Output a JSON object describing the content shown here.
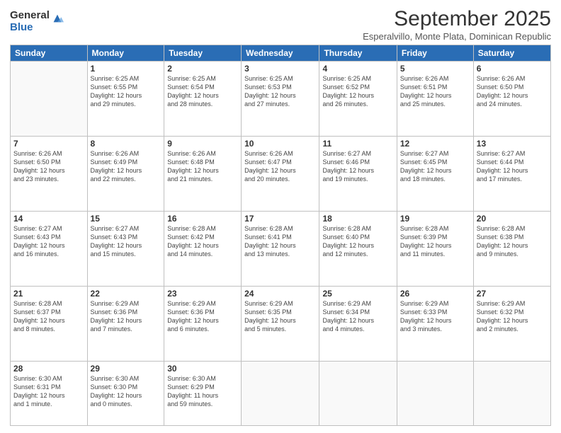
{
  "logo": {
    "general": "General",
    "blue": "Blue"
  },
  "header": {
    "month": "September 2025",
    "location": "Esperalvillo, Monte Plata, Dominican Republic"
  },
  "weekdays": [
    "Sunday",
    "Monday",
    "Tuesday",
    "Wednesday",
    "Thursday",
    "Friday",
    "Saturday"
  ],
  "weeks": [
    [
      {
        "day": "",
        "info": ""
      },
      {
        "day": "1",
        "info": "Sunrise: 6:25 AM\nSunset: 6:55 PM\nDaylight: 12 hours\nand 29 minutes."
      },
      {
        "day": "2",
        "info": "Sunrise: 6:25 AM\nSunset: 6:54 PM\nDaylight: 12 hours\nand 28 minutes."
      },
      {
        "day": "3",
        "info": "Sunrise: 6:25 AM\nSunset: 6:53 PM\nDaylight: 12 hours\nand 27 minutes."
      },
      {
        "day": "4",
        "info": "Sunrise: 6:25 AM\nSunset: 6:52 PM\nDaylight: 12 hours\nand 26 minutes."
      },
      {
        "day": "5",
        "info": "Sunrise: 6:26 AM\nSunset: 6:51 PM\nDaylight: 12 hours\nand 25 minutes."
      },
      {
        "day": "6",
        "info": "Sunrise: 6:26 AM\nSunset: 6:50 PM\nDaylight: 12 hours\nand 24 minutes."
      }
    ],
    [
      {
        "day": "7",
        "info": "Sunrise: 6:26 AM\nSunset: 6:50 PM\nDaylight: 12 hours\nand 23 minutes."
      },
      {
        "day": "8",
        "info": "Sunrise: 6:26 AM\nSunset: 6:49 PM\nDaylight: 12 hours\nand 22 minutes."
      },
      {
        "day": "9",
        "info": "Sunrise: 6:26 AM\nSunset: 6:48 PM\nDaylight: 12 hours\nand 21 minutes."
      },
      {
        "day": "10",
        "info": "Sunrise: 6:26 AM\nSunset: 6:47 PM\nDaylight: 12 hours\nand 20 minutes."
      },
      {
        "day": "11",
        "info": "Sunrise: 6:27 AM\nSunset: 6:46 PM\nDaylight: 12 hours\nand 19 minutes."
      },
      {
        "day": "12",
        "info": "Sunrise: 6:27 AM\nSunset: 6:45 PM\nDaylight: 12 hours\nand 18 minutes."
      },
      {
        "day": "13",
        "info": "Sunrise: 6:27 AM\nSunset: 6:44 PM\nDaylight: 12 hours\nand 17 minutes."
      }
    ],
    [
      {
        "day": "14",
        "info": "Sunrise: 6:27 AM\nSunset: 6:43 PM\nDaylight: 12 hours\nand 16 minutes."
      },
      {
        "day": "15",
        "info": "Sunrise: 6:27 AM\nSunset: 6:43 PM\nDaylight: 12 hours\nand 15 minutes."
      },
      {
        "day": "16",
        "info": "Sunrise: 6:28 AM\nSunset: 6:42 PM\nDaylight: 12 hours\nand 14 minutes."
      },
      {
        "day": "17",
        "info": "Sunrise: 6:28 AM\nSunset: 6:41 PM\nDaylight: 12 hours\nand 13 minutes."
      },
      {
        "day": "18",
        "info": "Sunrise: 6:28 AM\nSunset: 6:40 PM\nDaylight: 12 hours\nand 12 minutes."
      },
      {
        "day": "19",
        "info": "Sunrise: 6:28 AM\nSunset: 6:39 PM\nDaylight: 12 hours\nand 11 minutes."
      },
      {
        "day": "20",
        "info": "Sunrise: 6:28 AM\nSunset: 6:38 PM\nDaylight: 12 hours\nand 9 minutes."
      }
    ],
    [
      {
        "day": "21",
        "info": "Sunrise: 6:28 AM\nSunset: 6:37 PM\nDaylight: 12 hours\nand 8 minutes."
      },
      {
        "day": "22",
        "info": "Sunrise: 6:29 AM\nSunset: 6:36 PM\nDaylight: 12 hours\nand 7 minutes."
      },
      {
        "day": "23",
        "info": "Sunrise: 6:29 AM\nSunset: 6:36 PM\nDaylight: 12 hours\nand 6 minutes."
      },
      {
        "day": "24",
        "info": "Sunrise: 6:29 AM\nSunset: 6:35 PM\nDaylight: 12 hours\nand 5 minutes."
      },
      {
        "day": "25",
        "info": "Sunrise: 6:29 AM\nSunset: 6:34 PM\nDaylight: 12 hours\nand 4 minutes."
      },
      {
        "day": "26",
        "info": "Sunrise: 6:29 AM\nSunset: 6:33 PM\nDaylight: 12 hours\nand 3 minutes."
      },
      {
        "day": "27",
        "info": "Sunrise: 6:29 AM\nSunset: 6:32 PM\nDaylight: 12 hours\nand 2 minutes."
      }
    ],
    [
      {
        "day": "28",
        "info": "Sunrise: 6:30 AM\nSunset: 6:31 PM\nDaylight: 12 hours\nand 1 minute."
      },
      {
        "day": "29",
        "info": "Sunrise: 6:30 AM\nSunset: 6:30 PM\nDaylight: 12 hours\nand 0 minutes."
      },
      {
        "day": "30",
        "info": "Sunrise: 6:30 AM\nSunset: 6:29 PM\nDaylight: 11 hours\nand 59 minutes."
      },
      {
        "day": "",
        "info": ""
      },
      {
        "day": "",
        "info": ""
      },
      {
        "day": "",
        "info": ""
      },
      {
        "day": "",
        "info": ""
      }
    ]
  ]
}
